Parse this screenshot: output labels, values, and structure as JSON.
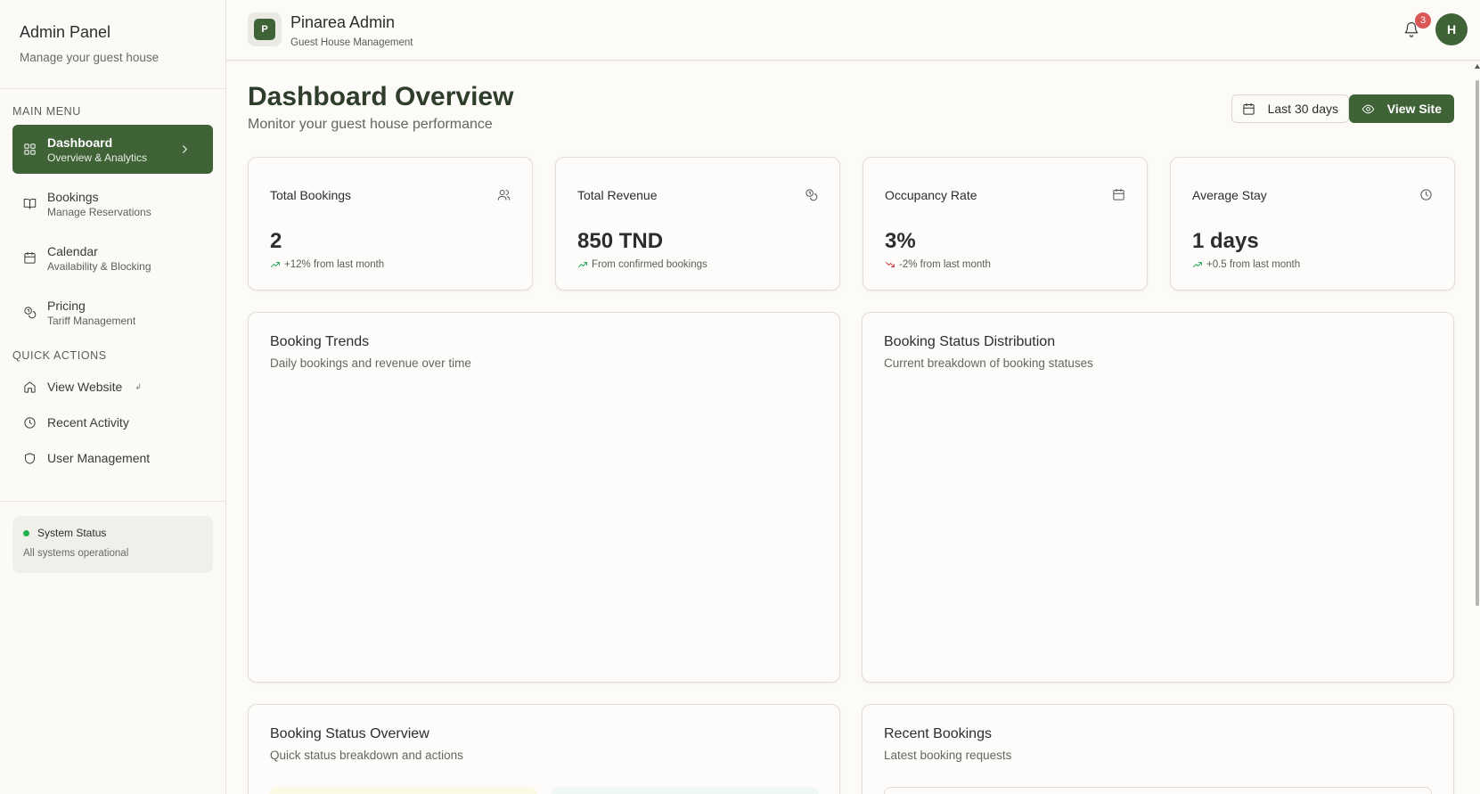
{
  "sidebar": {
    "title": "Admin Panel",
    "subtitle": "Manage your guest house",
    "main_menu_label": "MAIN MENU",
    "items": [
      {
        "label": "Dashboard",
        "desc": "Overview & Analytics",
        "icon": "dashboard-grid-icon",
        "active": true
      },
      {
        "label": "Bookings",
        "desc": "Manage Reservations",
        "icon": "book-open-icon"
      },
      {
        "label": "Calendar",
        "desc": "Availability & Blocking",
        "icon": "calendar-icon"
      },
      {
        "label": "Pricing",
        "desc": "Tariff Management",
        "icon": "coins-icon"
      }
    ],
    "quick_actions_label": "QUICK ACTIONS",
    "quick_actions": [
      {
        "label": "View Website",
        "icon": "home-icon",
        "external": true
      },
      {
        "label": "Recent Activity",
        "icon": "clock-icon"
      },
      {
        "label": "User Management",
        "icon": "shield-icon"
      }
    ],
    "system_status": {
      "label": "System Status",
      "message": "All systems operational",
      "color": "#22b14c"
    }
  },
  "header": {
    "logo_letter": "P",
    "title": "Pinarea Admin",
    "subtitle": "Guest House Management",
    "notification_count": "3",
    "avatar_letter": "H"
  },
  "main": {
    "title": "Dashboard Overview",
    "subtitle": "Monitor your guest house performance",
    "range_button": "Last 30 days",
    "view_site_button": "View Site",
    "stats": [
      {
        "label": "Total Bookings",
        "value": "2",
        "trend": "+12% from last month",
        "direction": "up",
        "icon": "users-icon"
      },
      {
        "label": "Total Revenue",
        "value": "850 TND",
        "trend": "From confirmed bookings",
        "direction": "up",
        "icon": "coins-icon"
      },
      {
        "label": "Occupancy Rate",
        "value": "3%",
        "trend": "-2% from last month",
        "direction": "down",
        "icon": "calendar-icon"
      },
      {
        "label": "Average Stay",
        "value": "1 days",
        "trend": "+0.5 from last month",
        "direction": "up",
        "icon": "clock-icon"
      }
    ],
    "panels": {
      "trends": {
        "title": "Booking Trends",
        "subtitle": "Daily bookings and revenue over time"
      },
      "distribution": {
        "title": "Booking Status Distribution",
        "subtitle": "Current breakdown of booking statuses"
      },
      "status_overview": {
        "title": "Booking Status Overview",
        "subtitle": "Quick status breakdown and actions"
      },
      "recent": {
        "title": "Recent Bookings",
        "subtitle": "Latest booking requests"
      }
    }
  },
  "colors": {
    "brand": "#3f6237",
    "up": "#22a355",
    "down": "#d13b3b",
    "badge": "#d95757"
  }
}
